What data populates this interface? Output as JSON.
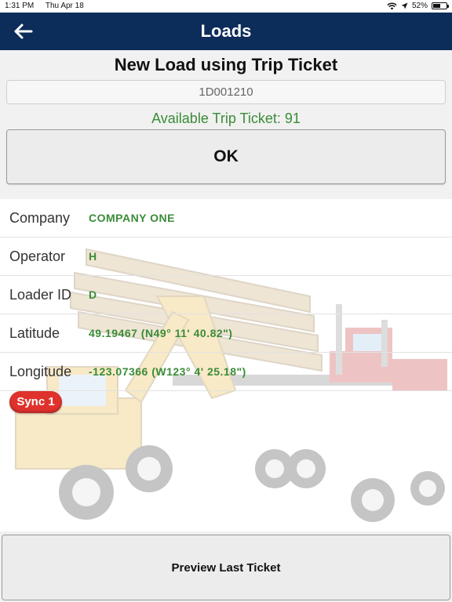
{
  "status_bar": {
    "time": "1:31 PM",
    "date": "Thu Apr 18",
    "battery": "52%",
    "battery_level": 0.52,
    "icons": [
      "wifi-icon",
      "location-arrow-icon",
      "battery-icon"
    ]
  },
  "nav": {
    "title": "Loads",
    "back_icon": "back-arrow-icon",
    "color": "#0c2c5a"
  },
  "form": {
    "heading": "New Load using Trip Ticket",
    "ticket_value": "1D001210",
    "available_text": "Available Trip Ticket: 91",
    "ok_label": "OK"
  },
  "details": [
    {
      "label": "Company",
      "value": "COMPANY ONE"
    },
    {
      "label": "Operator",
      "value": "H"
    },
    {
      "label": "Loader ID",
      "value": "D"
    },
    {
      "label": "Latitude",
      "value": "49.19467 (N49° 11' 40.82\")"
    },
    {
      "label": "Longitude",
      "value": "-123.07366 (W123° 4' 25.18\")"
    }
  ],
  "sync": {
    "label": "Sync 1",
    "color": "#e0322d"
  },
  "footer": {
    "preview_label": "Preview Last Ticket"
  },
  "colors": {
    "accent_green": "#3a8c37",
    "nav_blue": "#0c2c5a"
  }
}
